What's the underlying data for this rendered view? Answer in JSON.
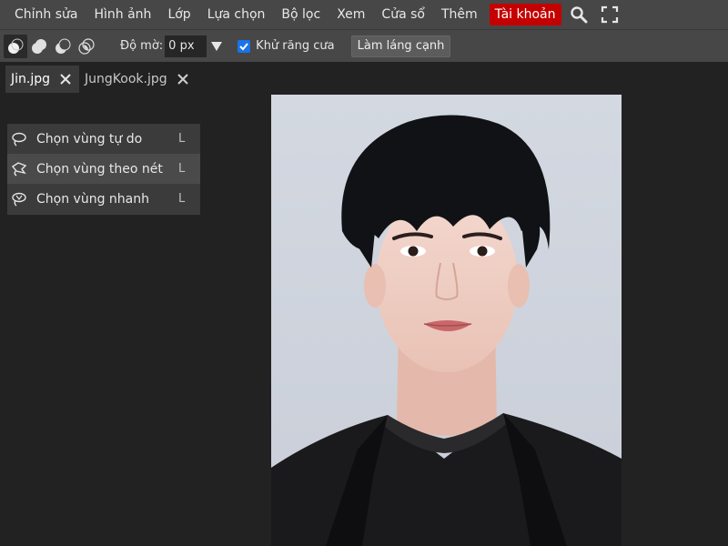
{
  "menubar": {
    "items": [
      "Chỉnh sửa",
      "Hình ảnh",
      "Lớp",
      "Lựa chọn",
      "Bộ lọc",
      "Xem",
      "Cửa sổ",
      "Thêm"
    ],
    "account_label": "Tài khoản",
    "icons": [
      "search-icon",
      "fullscreen-icon"
    ],
    "account_color": "#c40000"
  },
  "options": {
    "modes": [
      "new-selection-icon",
      "add-selection-icon",
      "subtract-selection-icon",
      "intersect-selection-icon"
    ],
    "feather_label": "Độ mờ:",
    "feather_value": "0 px",
    "antialias_label": "Khử răng cưa",
    "antialias_checked": true,
    "refine_label": "Làm láng cạnh"
  },
  "tabs": [
    {
      "label": "Jin.jpg",
      "active": true
    },
    {
      "label": "JungKook.jpg",
      "active": false
    }
  ],
  "tool_flyout": {
    "items": [
      {
        "label": "Chọn vùng tự do",
        "key": "L",
        "icon": "lasso-icon"
      },
      {
        "label": "Chọn vùng theo nét",
        "key": "L",
        "icon": "polygonal-lasso-icon"
      },
      {
        "label": "Chọn vùng nhanh",
        "key": "L",
        "icon": "magnetic-lasso-icon"
      }
    ]
  },
  "colors": {
    "menubar_bg": "#474747",
    "workspace_bg": "#222222",
    "checkbox_accent": "#1a73e8"
  }
}
